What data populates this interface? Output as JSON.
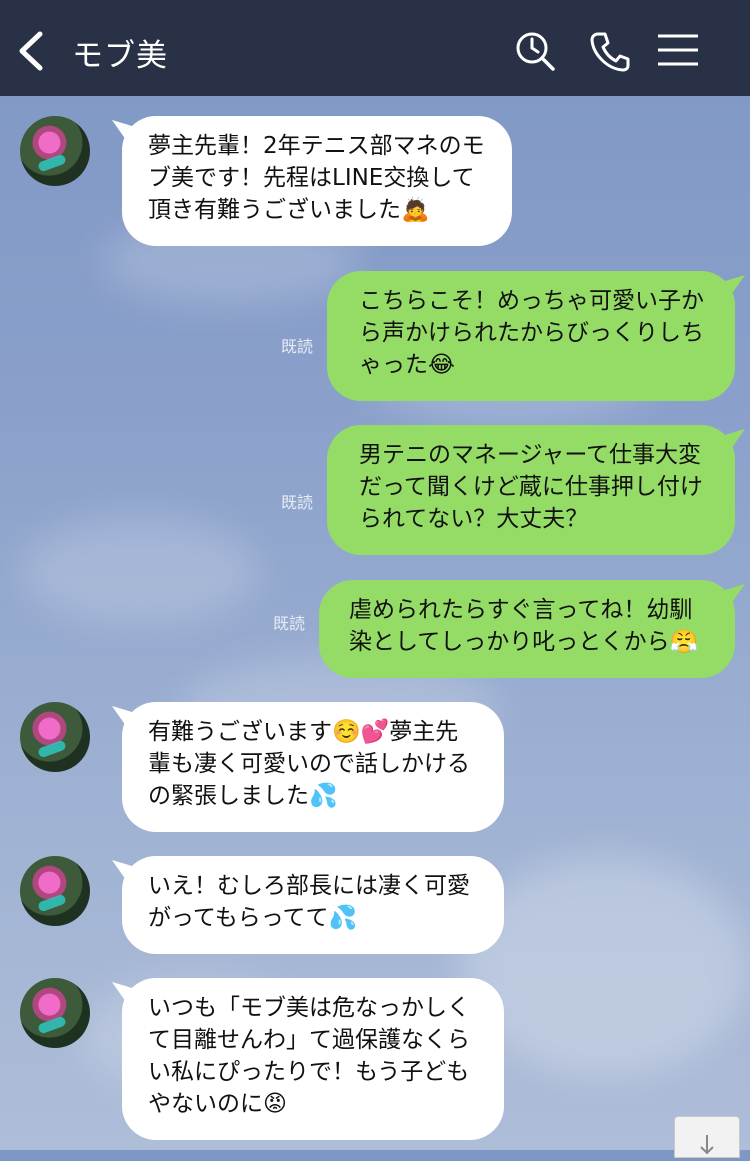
{
  "header": {
    "title": "モブ美"
  },
  "messages": [
    {
      "side": "left",
      "text": "夢主先輩！2年テニス部マネのモブ美です！先程はLINE交換して頂き有難うございました🙇"
    },
    {
      "side": "right",
      "read": "既読",
      "text": "こちらこそ！めっちゃ可愛い子から声かけられたからびっくりしちゃった😂"
    },
    {
      "side": "right",
      "read": "既読",
      "text": "男テニのマネージャーて仕事大変だって聞くけど蔵に仕事押し付けられてない？大丈夫？"
    },
    {
      "side": "right",
      "read": "既読",
      "text": "虐められたらすぐ言ってね！幼馴染としてしっかり叱っとくから😤"
    },
    {
      "side": "left",
      "text": "有難うございます☺️💕夢主先輩も凄く可愛いので話しかけるの緊張しました💦"
    },
    {
      "side": "left",
      "text": "いえ！むしろ部長には凄く可愛がってもらってて💦"
    },
    {
      "side": "left",
      "text": "いつも「モブ美は危なっかしくて目離せんわ」て過保護なくらい私にぴったりで！もう子どもやないのに😡"
    }
  ],
  "colors": {
    "header_bg": "#283145",
    "outgoing_bubble": "#95dc66",
    "incoming_bubble": "#ffffff"
  },
  "icons": [
    "back-icon",
    "search-icon",
    "call-icon",
    "menu-icon",
    "scroll-down-icon"
  ]
}
